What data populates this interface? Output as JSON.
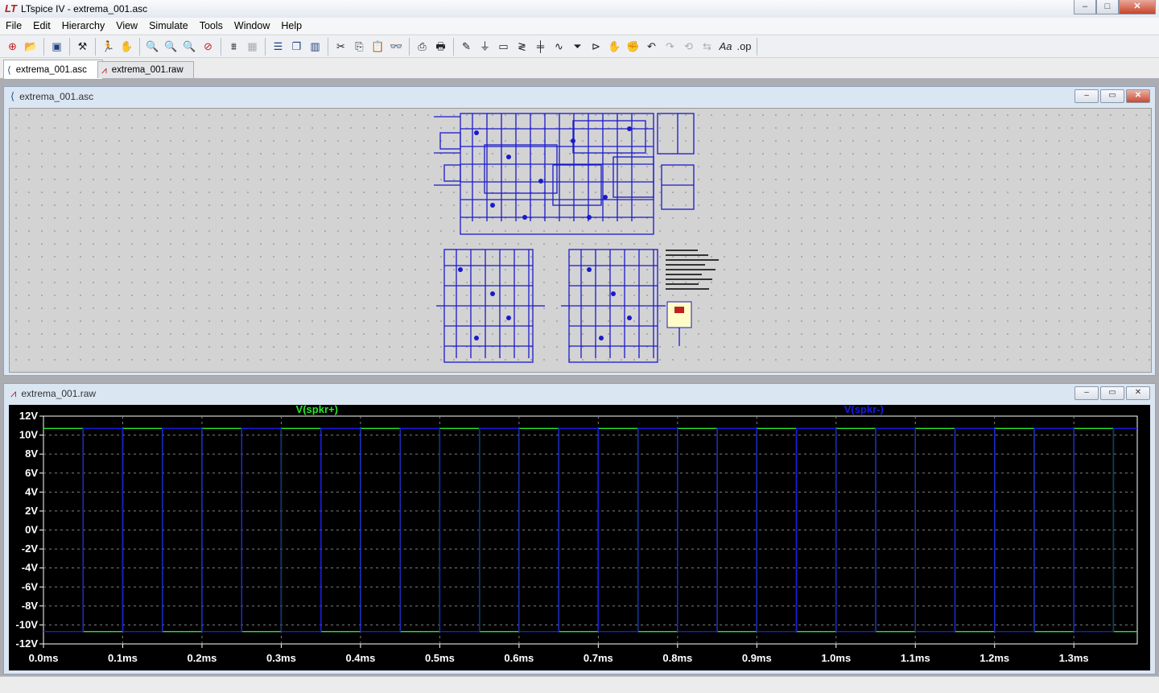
{
  "window": {
    "title": "LTspice IV - extrema_001.asc",
    "minimize": "–",
    "maximize": "□",
    "close": "✕"
  },
  "menu": [
    "File",
    "Edit",
    "Hierarchy",
    "View",
    "Simulate",
    "Tools",
    "Window",
    "Help"
  ],
  "toolbar_icons": [
    "new-schematic-icon",
    "open-icon",
    "save-icon",
    "control-panel-icon",
    "run-icon",
    "halt-icon",
    "zoom-in-icon",
    "zoom-full-icon",
    "zoom-out-icon",
    "zoom-cancel-icon",
    "autorange-icon",
    "grid-icon",
    "tile-horizontal-icon",
    "cascade-icon",
    "tile-vertical-icon",
    "cut-icon",
    "copy-icon",
    "paste-icon",
    "find-icon",
    "print-setup-icon",
    "print-icon",
    "draw-wire-icon",
    "ground-icon",
    "net-label-icon",
    "resistor-icon",
    "capacitor-icon",
    "inductor-icon",
    "diode-icon",
    "component-icon",
    "move-icon",
    "drag-icon",
    "undo-icon",
    "redo-icon",
    "rotate-icon",
    "mirror-icon",
    "text-icon",
    "spice-directive-icon"
  ],
  "tabs": [
    {
      "label": "extrema_001.asc",
      "icon": "schematic-icon",
      "active": true
    },
    {
      "label": "extrema_001.raw",
      "icon": "waveform-icon",
      "active": false
    }
  ],
  "schematic_window": {
    "title": "extrema_001.asc"
  },
  "waveform_window": {
    "title": "extrema_001.raw"
  },
  "chart_data": {
    "type": "line",
    "xlabel": "",
    "ylabel": "",
    "xlim": [
      0,
      1.38
    ],
    "ylim": [
      -12,
      12
    ],
    "x_ticks": [
      "0.0ms",
      "0.1ms",
      "0.2ms",
      "0.3ms",
      "0.4ms",
      "0.5ms",
      "0.6ms",
      "0.7ms",
      "0.8ms",
      "0.9ms",
      "1.0ms",
      "1.1ms",
      "1.2ms",
      "1.3ms"
    ],
    "y_ticks": [
      "12V",
      "10V",
      "8V",
      "6V",
      "4V",
      "2V",
      "0V",
      "-2V",
      "-4V",
      "-6V",
      "-8V",
      "-10V",
      "-12V"
    ],
    "grid": true,
    "series": [
      {
        "name": "V(spkr+)",
        "color": "#27e827",
        "type": "square",
        "high": 10.7,
        "low": -10.7,
        "period_ms": 0.1,
        "start_ms": 0.0,
        "initial": "high"
      },
      {
        "name": "V(spkr-)",
        "color": "#1a1ae0",
        "type": "square",
        "high": 10.7,
        "low": -10.7,
        "period_ms": 0.1,
        "start_ms": 0.0,
        "initial": "low"
      }
    ]
  }
}
